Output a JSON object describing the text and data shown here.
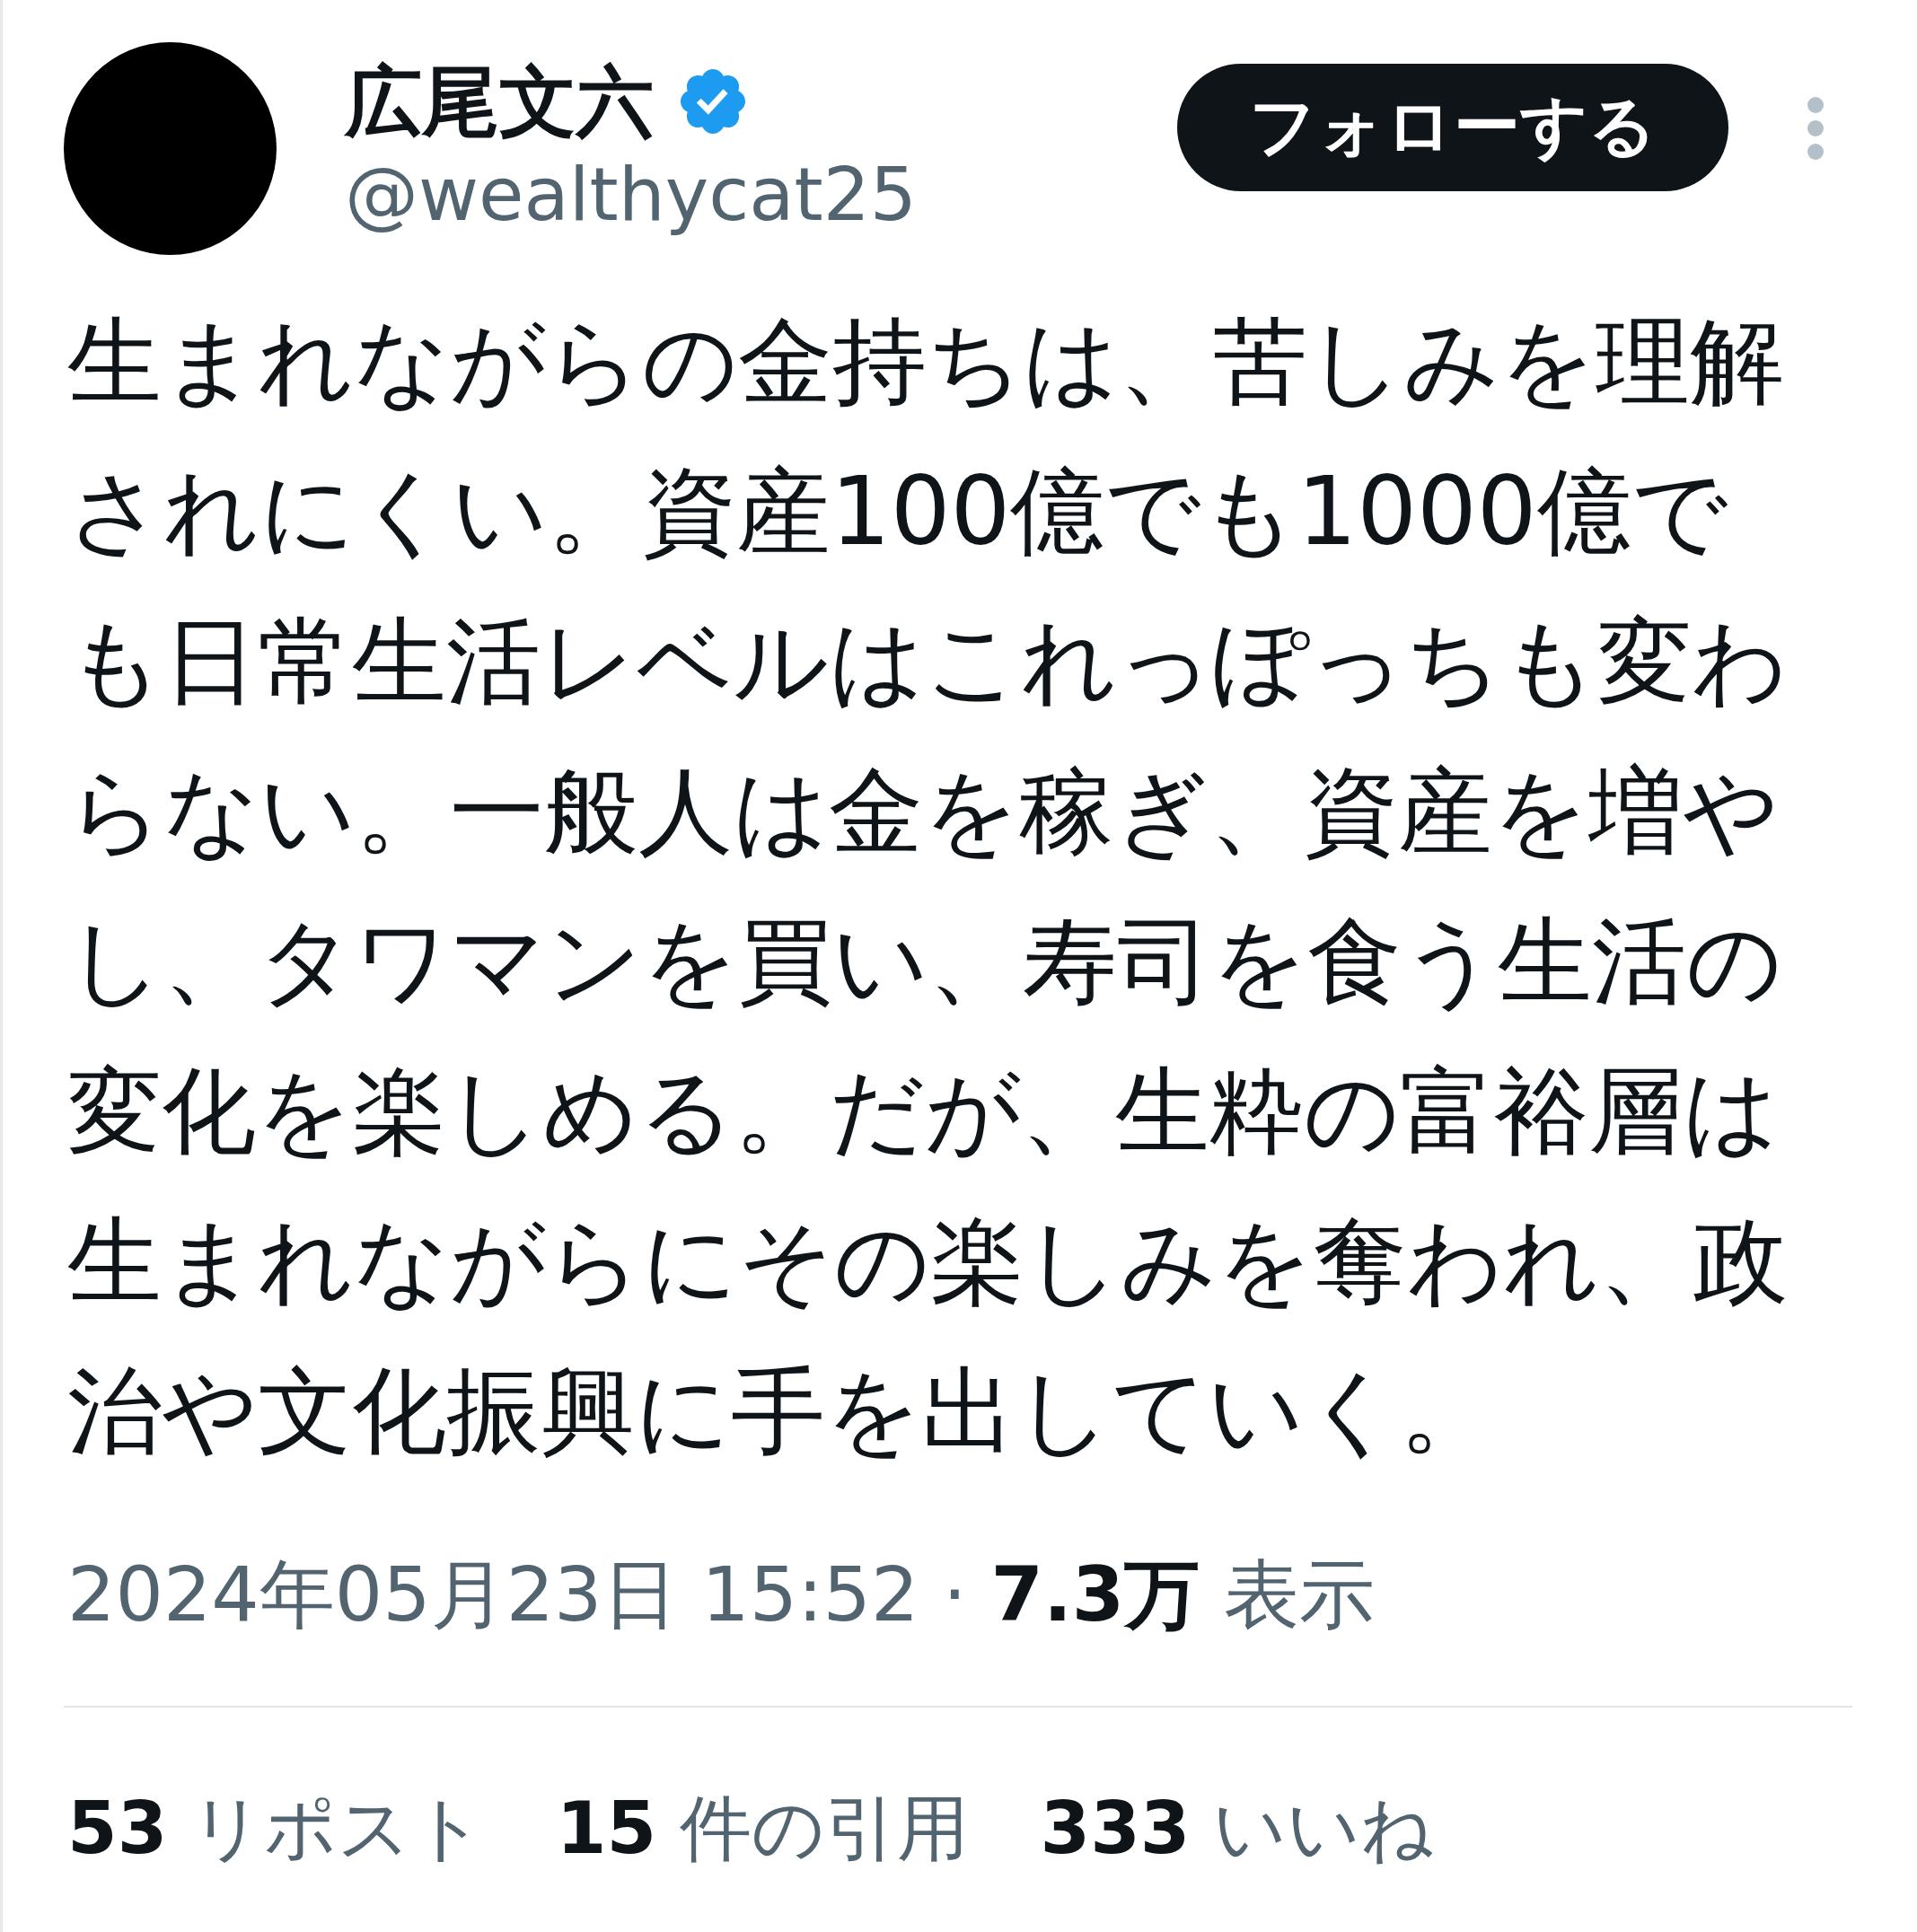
{
  "author": {
    "name": "広尾文六",
    "verified": true,
    "handle": "@wealthycat25"
  },
  "follow_button": {
    "label": "フォローする"
  },
  "post": {
    "text": "生まれながらの金持ちは、苦しみを理解されにくい。資産100億でも1000億でも日常生活レベルはこれっぽっちも変わらない。一般人は金を稼ぎ、資産を増やし、タワマンを買い、寿司を食う生活の変化を楽しめる。だが、生粋の富裕層は生まれながらにその楽しみを奪われ、政治や文化振興に手を出していく。"
  },
  "meta": {
    "timestamp": "2024年05月23日 15:52",
    "separator": "·",
    "views_count": "7.3万",
    "views_label": "表示"
  },
  "stats": [
    {
      "count": "53",
      "label": "リポスト"
    },
    {
      "count": "15",
      "label": "件の引用"
    },
    {
      "count": "333",
      "label": "いいね"
    }
  ]
}
